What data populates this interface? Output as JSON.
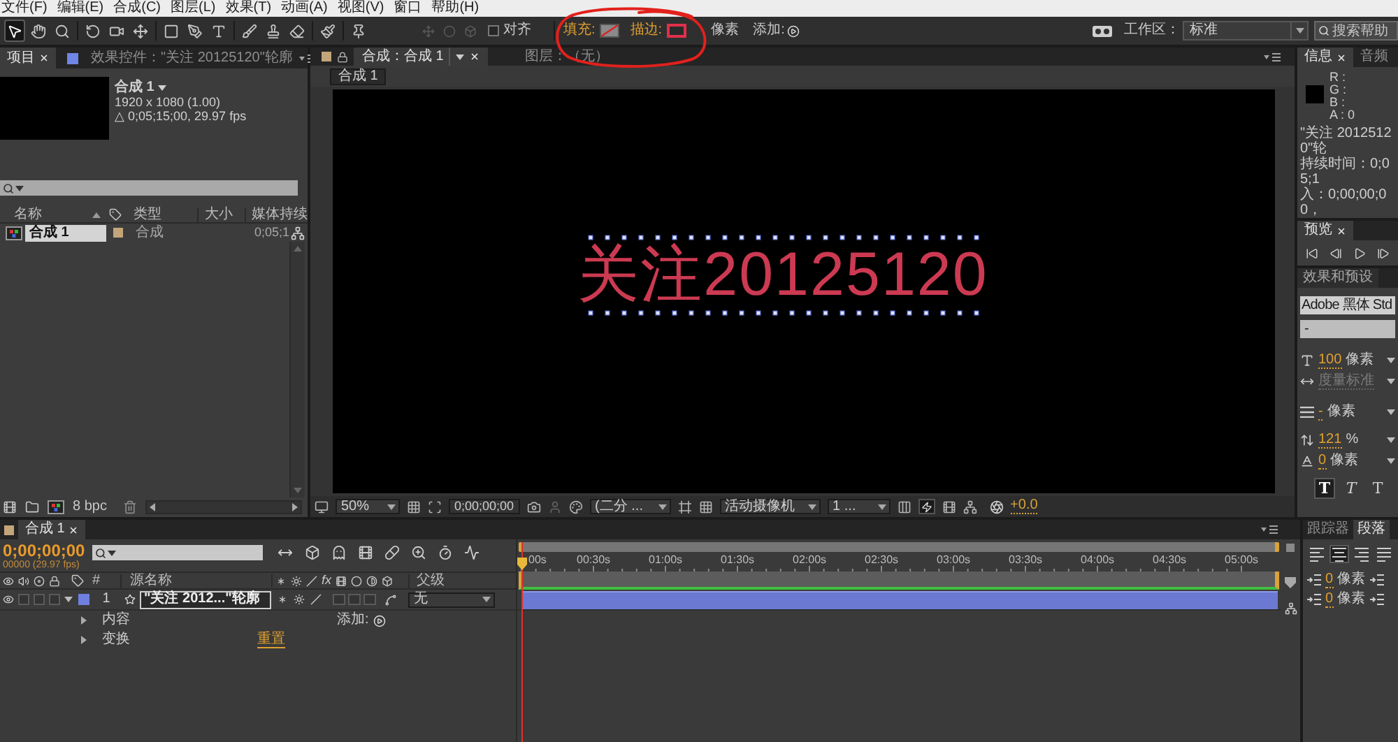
{
  "menu": [
    "文件(F)",
    "编辑(E)",
    "合成(C)",
    "图层(L)",
    "效果(T)",
    "动画(A)",
    "视图(V)",
    "窗口",
    "帮助(H)"
  ],
  "toolbar": {
    "tools": [
      {
        "selected": true
      },
      {
        "selected": false
      },
      {
        "selected": false
      },
      {
        "selected": false
      },
      {
        "selected": false
      },
      {
        "selected": false
      },
      {
        "selected": false
      },
      {
        "selected": false
      },
      {
        "selected": false
      },
      {
        "selected": false
      },
      {
        "selected": false
      },
      {
        "selected": false
      },
      {
        "selected": false
      },
      {
        "selected": false
      }
    ],
    "snap": {
      "label": "对齐",
      "checked": false
    },
    "fill_label": "填充:",
    "stroke_label": "描边:",
    "stroke_unit": "像素",
    "add_label": "添加:",
    "workspace": {
      "label": "工作区：",
      "value": "标准"
    },
    "help_search": {
      "placeholder": "搜索帮助"
    }
  },
  "project_panel": {
    "tabs": [
      {
        "label": "项目",
        "selected": true
      },
      {
        "label": "效果控件：\"关注 20125120\"轮廓",
        "selected": false
      }
    ],
    "preview": {
      "name": "合成 1",
      "size": "1920 x 1080 (1.00)",
      "duration": "△ 0;05;15;00, 29.97 fps"
    },
    "columns": [
      "名称",
      "类型",
      "大小",
      "媒体持续"
    ],
    "items": [
      {
        "name": "合成 1",
        "type": "合成",
        "duration": "0;05;1",
        "color": "#c4a57a",
        "selected": true
      }
    ],
    "bit_depth": "8 bpc"
  },
  "viewer": {
    "tabs": [
      {
        "label": "合成：合成 1",
        "selected": true
      },
      {
        "label": "图层：（无）",
        "selected": false
      }
    ],
    "breadcrumb": "合成 1",
    "canvas_text": "关注20125120",
    "magnification": "50%",
    "timecode": "0;00;00;00",
    "resolution": "(二分 ...",
    "camera": "活动摄像机",
    "views": "1 ...",
    "exposure": "+0.0"
  },
  "info_panel": {
    "tabs": [
      {
        "label": "信息",
        "selected": true
      },
      {
        "label": "音频",
        "selected": false
      }
    ],
    "channels": [
      "R :",
      "G :",
      "B :",
      "A : 0"
    ],
    "lines": [
      "\"关注 20125120\"轮",
      "持续时间：0;05;1",
      "入：0;00;00;00，"
    ]
  },
  "preview_panel": {
    "tab": "预览"
  },
  "character_panel": {
    "tab": "效果和预设",
    "font": "Adobe 黑体 Std",
    "style": "-",
    "rows": [
      {
        "kind": "size",
        "value": "100",
        "unit": "像素",
        "disabled": false
      },
      {
        "kind": "kerning",
        "value": "度量标准",
        "disabled": true
      },
      {
        "kind": "leading",
        "value": "-",
        "unit": "像素",
        "disabled": false
      },
      {
        "kind": "vertical_scale",
        "value": "121",
        "unit": "%",
        "disabled": false
      },
      {
        "kind": "baseline_shift",
        "value": "0",
        "unit": "像素",
        "disabled": false
      }
    ],
    "style_buttons": [
      {
        "label": "T",
        "selected": true
      },
      {
        "label": "T",
        "selected": false
      },
      {
        "label": "T",
        "selected": false
      }
    ]
  },
  "timeline": {
    "tab": "合成 1",
    "timecode": "0;00;00;00",
    "fps": "00000 (29.97 fps)",
    "columns": [
      "#",
      "源名称",
      "fx",
      "父级"
    ],
    "layers": [
      {
        "index": "1",
        "name": "\"关注 2012...\"轮廓",
        "color": "#6f80e0",
        "parent": "无",
        "expanded": true,
        "children": [
          {
            "label": "内容",
            "kind": "add",
            "action": "添加:",
            "expanded": false
          },
          {
            "label": "变换",
            "kind": "reset",
            "action": "重置",
            "expanded": false
          }
        ]
      }
    ],
    "ruler": [
      "00s",
      "00:30s",
      "01:00s",
      "01:30s",
      "02:00s",
      "02:30s",
      "03:00s",
      "03:30s",
      "04:00s",
      "04:30s",
      "05:00s"
    ]
  },
  "paragraph_panel": {
    "tabs": [
      {
        "label": "跟踪器",
        "selected": false
      },
      {
        "label": "段落",
        "selected": true
      }
    ],
    "align_buttons": [
      {
        "selected": false
      },
      {
        "selected": true
      },
      {
        "selected": false
      },
      {
        "selected": false
      }
    ],
    "indents": [
      {
        "value": "0",
        "unit": "像素"
      },
      {
        "value": "0",
        "unit": "像素"
      }
    ]
  }
}
